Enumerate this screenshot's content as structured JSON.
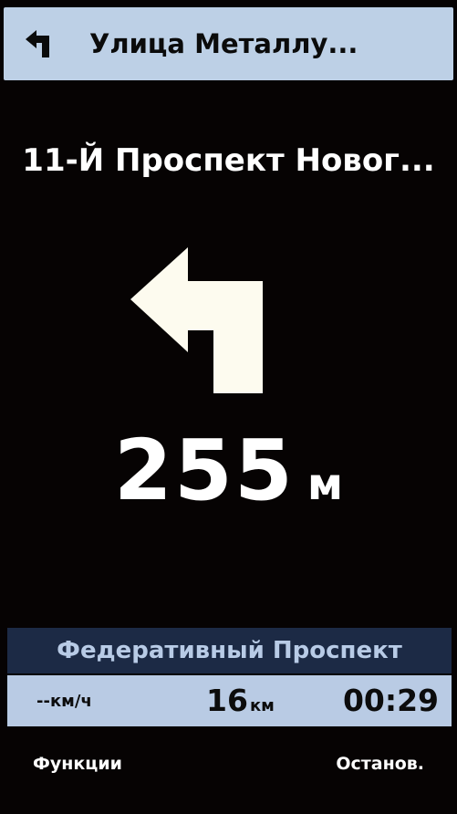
{
  "next_street": {
    "name": "Улица Металлу...",
    "icon": "turn-left-icon"
  },
  "current_street": "11-Й Проспект Новог...",
  "maneuver": {
    "icon": "turn-left-arrow-icon"
  },
  "distance": {
    "value": "255",
    "unit": "м"
  },
  "route_panel": {
    "street": "Федеративный Проспект",
    "speed": "--км/ч",
    "remaining_distance": {
      "value": "16",
      "unit": "км"
    },
    "remaining_time": "00:29"
  },
  "softkeys": {
    "left": "Функции",
    "right": "Останов."
  },
  "colors": {
    "background": "#060303",
    "banner": "#bdd0e6",
    "panel_dark": "#1c2a45",
    "panel_light": "#b9cbe4",
    "panel_text": "#b8cbe6"
  }
}
